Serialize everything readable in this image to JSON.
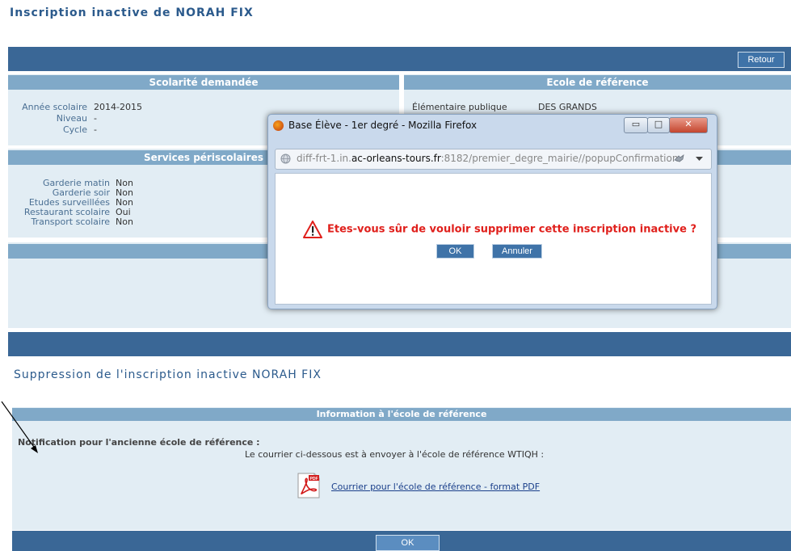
{
  "page_title": "Inscription inactive de NORAH FIX",
  "retour_label": "Retour",
  "scolarite": {
    "header": "Scolarité demandée",
    "annee_label": "Année scolaire",
    "annee_value": "2014-2015",
    "niveau_label": "Niveau",
    "niveau_value": "-",
    "cycle_label": "Cycle",
    "cycle_value": "-"
  },
  "ecole_ref": {
    "header": "Ecole de référence",
    "type": "Élémentaire publique",
    "name": "DES GRANDS"
  },
  "periscolaires": {
    "header": "Services périscolaires",
    "items": [
      {
        "label": "Garderie matin",
        "value": "Non"
      },
      {
        "label": "Garderie soir",
        "value": "Non"
      },
      {
        "label": "Etudes surveillées",
        "value": "Non"
      },
      {
        "label": "Restaurant scolaire",
        "value": "Oui"
      },
      {
        "label": "Transport scolaire",
        "value": "Non"
      }
    ]
  },
  "suppression_title": "Suppression de l'inscription inactive NORAH FIX",
  "information": {
    "header": "Information à l'école de référence",
    "notification": "Notification pour l'ancienne école de référence :",
    "courrier_text": "Le courrier ci-dessous est à envoyer à l'école de référence WTIQH :",
    "pdf_link": "Courrier pour l'école de référence - format PDF",
    "pdf_icon_text": "PDF"
  },
  "ok_label": "OK",
  "popup": {
    "window_title": "Base Élève - 1er degré - Mozilla Firefox",
    "url_prefix": "diff-frt-1.in.",
    "url_host": "ac-orleans-tours.fr",
    "url_rest": ":8182/premier_degre_mairie//popupConfirmation",
    "message": "Etes-vous sûr de vouloir supprimer cette inscription inactive ?",
    "ok_label": "OK",
    "cancel_label": "Annuler",
    "minimize_symbol": "▭",
    "maximize_symbol": "□",
    "close_symbol": "✕"
  }
}
